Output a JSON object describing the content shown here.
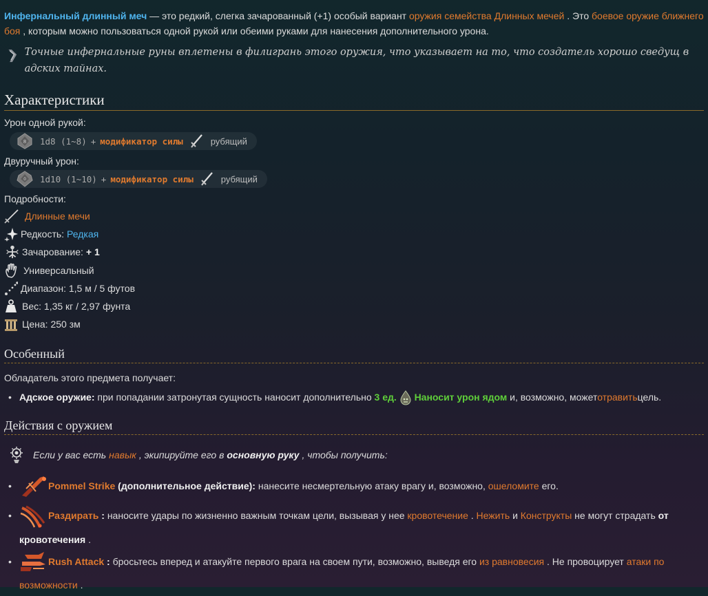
{
  "intro": {
    "name": "Инфернальный длинный меч",
    "t1": " — это редкий, слегка зачарованный (+1) особый вариант ",
    "link1": "оружия семейства Длинных мечей",
    "t2": " . Это ",
    "link2": "боевое оружие ближнего боя",
    "t3": " , которым можно пользоваться одной рукой или обеими руками для нанесения дополнительного урона."
  },
  "quote": "Точные инфернальные руны вплетены в филигрань этого оружия, что указывает на то, что создатель хорошо сведущ в адских тайнах.",
  "characteristics": {
    "heading": "Характеристики",
    "one_hand_label": "Урон одной рукой:",
    "one_hand": {
      "dice": "1d8 (1~8)",
      "plus": "+",
      "mod": "модификатор силы",
      "type": "рубящий"
    },
    "two_hand_label": "Двуручный урон:",
    "two_hand": {
      "dice": "1d10 (1~10)",
      "plus": "+",
      "mod": "модификатор силы",
      "type": "рубящий"
    },
    "details_label": "Подробности:",
    "family": "Длинные мечи",
    "rarity_label": "Редкость: ",
    "rarity": "Редкая",
    "ench_label": "Зачарование: ",
    "ench": "+ 1",
    "versatile": "Универсальный",
    "range": "Диапазон: 1,5 м / 5 футов",
    "weight": "Вес: 1,35 кг / 2,97 фунта",
    "price": "Цена: 250 зм"
  },
  "special": {
    "heading": "Особенный",
    "intro": "Обладатель этого предмета получает:",
    "item_title": "Адское оружие:",
    "item_t1": " при попадании затронутая сущность наносит дополнительно ",
    "amount": "3 ед.",
    "poison_text": "Наносит урон ядом",
    "item_t2": " и, возможно, может",
    "poison_link": "отравить",
    "item_t3": "цель."
  },
  "actions": {
    "heading": "Действия с оружием",
    "hint_t1": "Если у вас есть ",
    "hint_link": "навык",
    "hint_t2": " , экипируйте его в ",
    "hint_bold": "основную руку",
    "hint_t3": " , чтобы получить:",
    "items": [
      {
        "name": "Pommel Strike",
        "tag": " (дополнительное действие):",
        "t1": " нанесите несмертельную атаку врагу и, возможно, ",
        "link": "ошеломите",
        "t2": " его."
      },
      {
        "name": "Раздирать",
        "tag": " :",
        "t1": " наносите удары по жизненно важным точкам цели, вызывая у нее ",
        "link1": "кровотечение",
        "t2": " . ",
        "link2": "Нежить",
        "t3": " и ",
        "link3": "Конструкты",
        "t4": " не могут страдать ",
        "bold": "от кровотечения",
        "t5": " ."
      },
      {
        "name": "Rush Attack",
        "tag": " :",
        "t1": " бросьтесь вперед и атакуйте первого врага на своем пути, возможно, выведя его ",
        "link1": "из равновесия",
        "t2": " . Не провоцирует ",
        "link2": "атаки по возможности",
        "t3": " ."
      }
    ]
  },
  "colors": {
    "link": "#e07a2e",
    "name": "#4fb4ee",
    "poison": "#5fcf3a",
    "rule": "#8a6a2a"
  },
  "icons": [
    "scroll-icon",
    "d8-die-icon",
    "d10-die-icon",
    "sword-icon",
    "longsword-icon",
    "sparkle-icon",
    "enchant-icon",
    "hand-icon",
    "range-icon",
    "weight-icon",
    "coin-icon",
    "poison-icon",
    "skill-icon",
    "pommel-strike-icon",
    "lacerate-icon",
    "rush-attack-icon"
  ]
}
